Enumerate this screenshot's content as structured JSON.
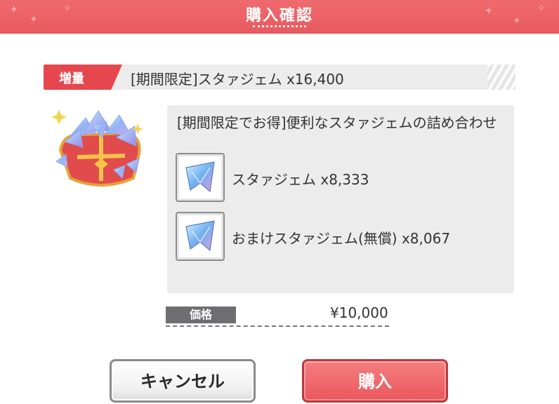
{
  "header": {
    "title": "購入確認"
  },
  "item": {
    "tag": "増量",
    "title": "[期間限定]スタァジェム x16,400"
  },
  "description": {
    "text": "[期間限定でお得]便利なスタァジェムの詰め合わせ",
    "contents": [
      {
        "label": "スタァジェム x8,333",
        "icon": "star-gem-icon"
      },
      {
        "label": "おまけスタァジェム(無償) x8,067",
        "icon": "star-gem-icon"
      }
    ]
  },
  "price": {
    "label": "価格",
    "value": "¥10,000"
  },
  "buttons": {
    "cancel": "キャンセル",
    "buy": "購入"
  },
  "colors": {
    "header": "#e85a5f",
    "tag": "#e6474f",
    "buy_button": "#e9575c",
    "price_label_bg": "#6e6e72"
  }
}
